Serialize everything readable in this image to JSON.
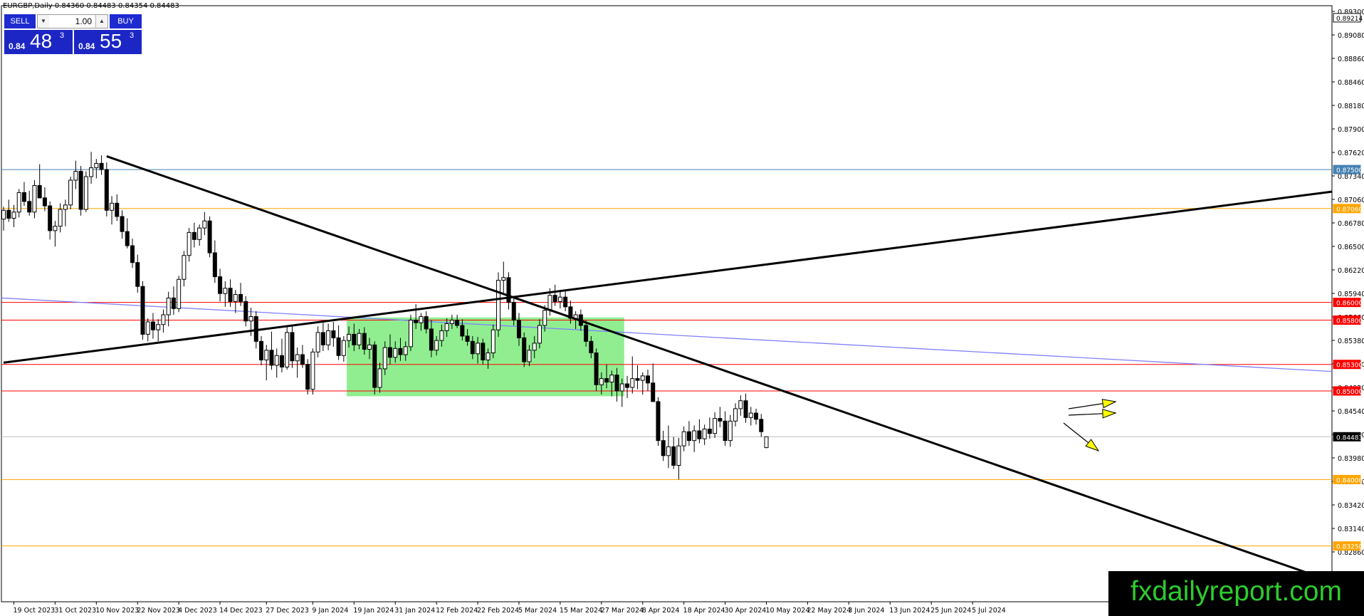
{
  "window": {
    "symbol_title": "EURGBP,Daily  0.84360 0.84483 0.84354 0.84483"
  },
  "trade_panel": {
    "sell_label": "SELL",
    "buy_label": "BUY",
    "volume": "1.00",
    "sell_price_prefix": "0.84",
    "sell_price_big": "48",
    "sell_price_sup": "3",
    "buy_price_prefix": "0.84",
    "buy_price_big": "55",
    "buy_price_sup": "3",
    "down_arrow_icon": "triangle-down",
    "up_arrow_icon": "triangle-up"
  },
  "watermark": {
    "text": "fxdailyreport.com"
  },
  "colors": {
    "up_candle": "#ffffff",
    "down_candle": "#000000",
    "buy_sell_panel": "#1e2bd0",
    "range_box": "#90ee90",
    "ma_line": "#8080ff",
    "level_red": "#ff0000",
    "level_orange": "#ffa500",
    "level_blue": "#4682b4",
    "watermark_text": "#2ecc2e"
  },
  "chart_data": {
    "type": "candlestick",
    "symbol": "EURGBP",
    "timeframe": "Daily",
    "current_price": 0.84483,
    "ylim": [
      0.8262,
      0.8935
    ],
    "x_tick_labels": [
      "19 Oct 2023",
      "31 Oct 2023",
      "10 Nov 2023",
      "22 Nov 2023",
      "4 Dec 2023",
      "14 Dec 2023",
      "27 Dec 2023",
      "9 Jan 2024",
      "19 Jan 2024",
      "31 Jan 2024",
      "12 Feb 2024",
      "22 Feb 2024",
      "5 Mar 2024",
      "15 Mar 2024",
      "27 Mar 2024",
      "8 Apr 2024",
      "18 Apr 2024",
      "30 Apr 2024",
      "10 May 2024",
      "22 May 2024",
      "3 Jun 2024",
      "13 Jun 2024",
      "25 Jun 2024",
      "5 Jul 2024"
    ],
    "y_tick_labels": [
      "0.89300",
      "0.89080",
      "0.88860",
      "0.88460",
      "0.88180",
      "0.87900",
      "0.87620",
      "0.87340",
      "0.87060",
      "0.86780",
      "0.86500",
      "0.86220",
      "0.85940",
      "0.85660",
      "0.85380",
      "0.85100",
      "0.84820",
      "0.84540",
      "0.84260",
      "0.83980",
      "0.83700",
      "0.83420",
      "0.83140",
      "0.82860"
    ],
    "price_tags": [
      {
        "value": "0.89214",
        "style": "plain"
      },
      {
        "value": "0.87500",
        "style": "blue"
      },
      {
        "value": "0.87060",
        "style": "orange"
      },
      {
        "value": "0.86000",
        "style": "red"
      },
      {
        "value": "0.85800",
        "style": "red"
      },
      {
        "value": "0.85300",
        "style": "red"
      },
      {
        "value": "0.85000",
        "style": "red"
      },
      {
        "value": "0.84483",
        "style": "current"
      },
      {
        "value": "0.84000",
        "style": "orange"
      },
      {
        "value": "0.83250",
        "style": "orange"
      }
    ],
    "horizontal_levels": [
      {
        "price": 0.875,
        "color": "blue"
      },
      {
        "price": 0.8706,
        "color": "orange"
      },
      {
        "price": 0.86,
        "color": "red"
      },
      {
        "price": 0.858,
        "color": "red"
      },
      {
        "price": 0.853,
        "color": "red"
      },
      {
        "price": 0.85,
        "color": "red"
      },
      {
        "price": 0.84483,
        "color": "gray"
      },
      {
        "price": 0.84,
        "color": "orange"
      },
      {
        "price": 0.8325,
        "color": "orange"
      }
    ],
    "trendlines": [
      {
        "kind": "descending",
        "from": {
          "date": "14 Nov 2023",
          "price": 0.8765
        },
        "to": {
          "date": "right edge",
          "price": 0.8285
        }
      },
      {
        "kind": "ascending",
        "from": {
          "date": "17 Oct 2023",
          "price": 0.8532
        },
        "to": {
          "date": "right edge",
          "price": 0.8725
        }
      }
    ],
    "moving_average": {
      "from_price": 0.8605,
      "to_price": 0.8522
    },
    "range_box": {
      "start": "18 Jan 2024",
      "end": "2 Apr 2024",
      "top": 0.8583,
      "bottom": 0.8494
    },
    "projection_arrows": [
      "up",
      "up",
      "down"
    ],
    "candles": {
      "start_date": "17 Oct 2023",
      "ohlc": [
        [
          0.8694,
          0.8708,
          0.8681,
          0.8704
        ],
        [
          0.8704,
          0.8716,
          0.8691,
          0.8695
        ],
        [
          0.8695,
          0.871,
          0.8685,
          0.8702
        ],
        [
          0.8702,
          0.8728,
          0.8696,
          0.8724
        ],
        [
          0.8724,
          0.8736,
          0.8709,
          0.8714
        ],
        [
          0.8714,
          0.8726,
          0.8698,
          0.8702
        ],
        [
          0.8702,
          0.8738,
          0.8695,
          0.8732
        ],
        [
          0.8732,
          0.8756,
          0.8724,
          0.8718
        ],
        [
          0.8718,
          0.873,
          0.8703,
          0.8709
        ],
        [
          0.8709,
          0.8714,
          0.8671,
          0.8681
        ],
        [
          0.8681,
          0.8692,
          0.8663,
          0.8686
        ],
        [
          0.8686,
          0.8712,
          0.8679,
          0.8705
        ],
        [
          0.8705,
          0.8716,
          0.8686,
          0.871
        ],
        [
          0.871,
          0.8742,
          0.8705,
          0.8738
        ],
        [
          0.8738,
          0.876,
          0.8728,
          0.8748
        ],
        [
          0.8748,
          0.8754,
          0.8698,
          0.8705
        ],
        [
          0.8705,
          0.8748,
          0.8702,
          0.8742
        ],
        [
          0.8742,
          0.877,
          0.8734,
          0.8752
        ],
        [
          0.8752,
          0.8762,
          0.874,
          0.8757
        ],
        [
          0.8757,
          0.8766,
          0.8744,
          0.875
        ],
        [
          0.875,
          0.8758,
          0.8697,
          0.8704
        ],
        [
          0.8704,
          0.872,
          0.8688,
          0.8712
        ],
        [
          0.8712,
          0.8722,
          0.8692,
          0.8697
        ],
        [
          0.8697,
          0.8704,
          0.8672,
          0.868
        ],
        [
          0.868,
          0.8695,
          0.8661,
          0.8664
        ],
        [
          0.8664,
          0.8672,
          0.8639,
          0.8645
        ],
        [
          0.8645,
          0.8654,
          0.8611,
          0.8618
        ],
        [
          0.8618,
          0.8624,
          0.8558,
          0.8564
        ],
        [
          0.8564,
          0.8582,
          0.8556,
          0.8578
        ],
        [
          0.8578,
          0.8588,
          0.8559,
          0.8569
        ],
        [
          0.8569,
          0.8581,
          0.8556,
          0.8575
        ],
        [
          0.8575,
          0.8592,
          0.8566,
          0.8586
        ],
        [
          0.8586,
          0.8612,
          0.8573,
          0.8605
        ],
        [
          0.8605,
          0.8618,
          0.8586,
          0.8593
        ],
        [
          0.8593,
          0.863,
          0.8589,
          0.8626
        ],
        [
          0.8626,
          0.8658,
          0.8618,
          0.8653
        ],
        [
          0.8653,
          0.8684,
          0.8646,
          0.8679
        ],
        [
          0.8679,
          0.869,
          0.8662,
          0.8671
        ],
        [
          0.8671,
          0.8688,
          0.8664,
          0.8684
        ],
        [
          0.8684,
          0.8702,
          0.8676,
          0.8692
        ],
        [
          0.8692,
          0.8697,
          0.8651,
          0.8656
        ],
        [
          0.8656,
          0.867,
          0.8622,
          0.8629
        ],
        [
          0.8629,
          0.8638,
          0.8601,
          0.861
        ],
        [
          0.861,
          0.8624,
          0.8595,
          0.8616
        ],
        [
          0.8616,
          0.8626,
          0.8595,
          0.8601
        ],
        [
          0.8601,
          0.8614,
          0.8588,
          0.8609
        ],
        [
          0.8609,
          0.8622,
          0.8596,
          0.8601
        ],
        [
          0.8601,
          0.8607,
          0.8573,
          0.8579
        ],
        [
          0.8579,
          0.8594,
          0.8562,
          0.8584
        ],
        [
          0.8584,
          0.859,
          0.8548,
          0.8556
        ],
        [
          0.8556,
          0.8562,
          0.8529,
          0.8535
        ],
        [
          0.8535,
          0.8552,
          0.8512,
          0.8546
        ],
        [
          0.8546,
          0.8567,
          0.8524,
          0.8529
        ],
        [
          0.8529,
          0.8548,
          0.8515,
          0.854
        ],
        [
          0.854,
          0.8559,
          0.8521,
          0.8527
        ],
        [
          0.8527,
          0.8572,
          0.8524,
          0.8566
        ],
        [
          0.8566,
          0.8574,
          0.8526,
          0.8534
        ],
        [
          0.8534,
          0.8549,
          0.8515,
          0.8541
        ],
        [
          0.8541,
          0.8552,
          0.8526,
          0.853
        ],
        [
          0.853,
          0.8536,
          0.8496,
          0.8502
        ],
        [
          0.8502,
          0.8548,
          0.8496,
          0.8544
        ],
        [
          0.8544,
          0.8573,
          0.8538,
          0.8566
        ],
        [
          0.8566,
          0.8578,
          0.8545,
          0.8552
        ],
        [
          0.8552,
          0.8576,
          0.8546,
          0.8568
        ],
        [
          0.8568,
          0.8578,
          0.855,
          0.856
        ],
        [
          0.856,
          0.8574,
          0.8535,
          0.854
        ],
        [
          0.854,
          0.8562,
          0.8533,
          0.8557
        ],
        [
          0.8557,
          0.8573,
          0.8549,
          0.8564
        ],
        [
          0.8564,
          0.8576,
          0.8545,
          0.8552
        ],
        [
          0.8552,
          0.857,
          0.8547,
          0.8565
        ],
        [
          0.8565,
          0.8572,
          0.8541,
          0.8547
        ],
        [
          0.8547,
          0.856,
          0.8536,
          0.8552
        ],
        [
          0.8552,
          0.8556,
          0.8496,
          0.8504
        ],
        [
          0.8504,
          0.8532,
          0.8498,
          0.8525
        ],
        [
          0.8525,
          0.8556,
          0.8518,
          0.8549
        ],
        [
          0.8549,
          0.8564,
          0.853,
          0.8538
        ],
        [
          0.8538,
          0.8556,
          0.8532,
          0.8548
        ],
        [
          0.8548,
          0.856,
          0.8534,
          0.8541
        ],
        [
          0.8541,
          0.8556,
          0.8534,
          0.855
        ],
        [
          0.855,
          0.8586,
          0.8545,
          0.858
        ],
        [
          0.858,
          0.8598,
          0.857,
          0.8577
        ],
        [
          0.8577,
          0.8588,
          0.8568,
          0.8584
        ],
        [
          0.8584,
          0.859,
          0.8565,
          0.857
        ],
        [
          0.857,
          0.858,
          0.8538,
          0.8546
        ],
        [
          0.8546,
          0.8562,
          0.854,
          0.8557
        ],
        [
          0.8557,
          0.8575,
          0.855,
          0.8568
        ],
        [
          0.8568,
          0.8582,
          0.8561,
          0.8576
        ],
        [
          0.8576,
          0.8586,
          0.857,
          0.858
        ],
        [
          0.858,
          0.8586,
          0.8571,
          0.8574
        ],
        [
          0.8574,
          0.8581,
          0.8557,
          0.8562
        ],
        [
          0.8562,
          0.857,
          0.8551,
          0.8556
        ],
        [
          0.8556,
          0.8562,
          0.8536,
          0.8542
        ],
        [
          0.8542,
          0.8561,
          0.8531,
          0.8554
        ],
        [
          0.8554,
          0.8559,
          0.853,
          0.8535
        ],
        [
          0.8535,
          0.8548,
          0.8525,
          0.8543
        ],
        [
          0.8543,
          0.8575,
          0.8537,
          0.8569
        ],
        [
          0.8569,
          0.8634,
          0.8561,
          0.8625
        ],
        [
          0.8625,
          0.8646,
          0.8611,
          0.8628
        ],
        [
          0.8628,
          0.8634,
          0.8592,
          0.86
        ],
        [
          0.86,
          0.8606,
          0.8574,
          0.858
        ],
        [
          0.858,
          0.8588,
          0.8551,
          0.856
        ],
        [
          0.856,
          0.8566,
          0.8527,
          0.8533
        ],
        [
          0.8533,
          0.8552,
          0.8528,
          0.8546
        ],
        [
          0.8546,
          0.8562,
          0.8537,
          0.8554
        ],
        [
          0.8554,
          0.8581,
          0.8548,
          0.8574
        ],
        [
          0.8574,
          0.8597,
          0.8567,
          0.8591
        ],
        [
          0.8591,
          0.8616,
          0.8585,
          0.8608
        ],
        [
          0.8608,
          0.862,
          0.8596,
          0.8601
        ],
        [
          0.8601,
          0.8614,
          0.8593,
          0.8606
        ],
        [
          0.8606,
          0.8613,
          0.859,
          0.8595
        ],
        [
          0.8595,
          0.8602,
          0.8576,
          0.8582
        ],
        [
          0.8582,
          0.859,
          0.857,
          0.8586
        ],
        [
          0.8586,
          0.8592,
          0.8568,
          0.8574
        ],
        [
          0.8574,
          0.858,
          0.855,
          0.8556
        ],
        [
          0.8556,
          0.8562,
          0.8537,
          0.8543
        ],
        [
          0.8543,
          0.8548,
          0.85,
          0.8507
        ],
        [
          0.8507,
          0.8521,
          0.8496,
          0.8514
        ],
        [
          0.8514,
          0.853,
          0.8503,
          0.851
        ],
        [
          0.851,
          0.8523,
          0.8494,
          0.8518
        ],
        [
          0.8518,
          0.8526,
          0.8488,
          0.85
        ],
        [
          0.85,
          0.8514,
          0.8482,
          0.8508
        ],
        [
          0.8508,
          0.8517,
          0.8492,
          0.8504
        ],
        [
          0.8504,
          0.8539,
          0.8497,
          0.8514
        ],
        [
          0.8514,
          0.8529,
          0.8502,
          0.8512
        ],
        [
          0.8512,
          0.8521,
          0.8496,
          0.8517
        ],
        [
          0.8517,
          0.8524,
          0.85,
          0.8509
        ],
        [
          0.8509,
          0.8531,
          0.8492,
          0.8488
        ],
        [
          0.8488,
          0.8493,
          0.8438,
          0.8444
        ],
        [
          0.8444,
          0.8455,
          0.8421,
          0.8427
        ],
        [
          0.8427,
          0.8461,
          0.8413,
          0.8437
        ],
        [
          0.8437,
          0.8448,
          0.8412,
          0.8416
        ],
        [
          0.8416,
          0.8447,
          0.84,
          0.8438
        ],
        [
          0.8438,
          0.846,
          0.8432,
          0.8454
        ],
        [
          0.8454,
          0.8466,
          0.8438,
          0.8444
        ],
        [
          0.8444,
          0.8461,
          0.8431,
          0.8455
        ],
        [
          0.8455,
          0.8468,
          0.8441,
          0.8446
        ],
        [
          0.8446,
          0.8462,
          0.8439,
          0.8457
        ],
        [
          0.8457,
          0.847,
          0.8446,
          0.8452
        ],
        [
          0.8452,
          0.8476,
          0.8447,
          0.8469
        ],
        [
          0.8469,
          0.8482,
          0.8459,
          0.8466
        ],
        [
          0.8466,
          0.8477,
          0.8438,
          0.8444
        ],
        [
          0.8444,
          0.8473,
          0.8437,
          0.8466
        ],
        [
          0.8466,
          0.8486,
          0.846,
          0.848
        ],
        [
          0.848,
          0.8495,
          0.8472,
          0.8489
        ],
        [
          0.8489,
          0.8497,
          0.8464,
          0.847
        ],
        [
          0.847,
          0.8482,
          0.8461,
          0.8475
        ],
        [
          0.8475,
          0.848,
          0.8462,
          0.8468
        ],
        [
          0.8468,
          0.8474,
          0.8448,
          0.8454
        ],
        [
          0.8436,
          0.84483,
          0.84354,
          0.84483
        ]
      ]
    }
  }
}
